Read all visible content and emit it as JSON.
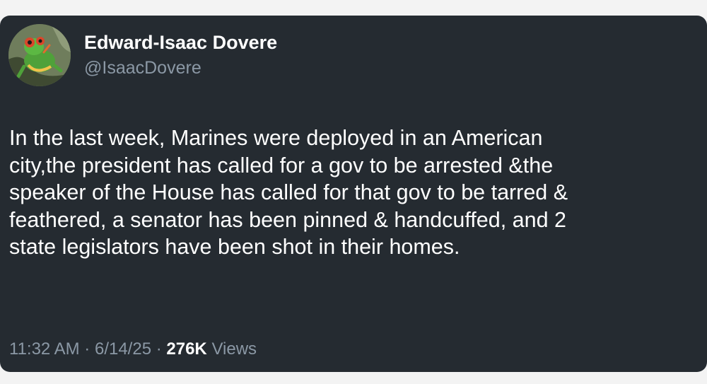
{
  "tweet": {
    "author_name": "Edward-Isaac Dovere",
    "author_handle": "@IsaacDovere",
    "avatar_icon": "frog-avatar-icon",
    "text": "In the last week, Marines were deployed in an American\ncity,the president has called for a gov to be arrested &the\nspeaker of the House has called for that gov to be tarred &\nfeathered, a senator has been pinned & handcuffed, and 2\nstate legislators have been shot in their homes.",
    "time": "11:32 AM",
    "separator": "·",
    "date": "6/14/25",
    "view_count": "276K",
    "views_label": "Views"
  },
  "colors": {
    "card_background": "#252b31",
    "primary_text": "#ffffff",
    "secondary_text": "#8b98a5"
  }
}
